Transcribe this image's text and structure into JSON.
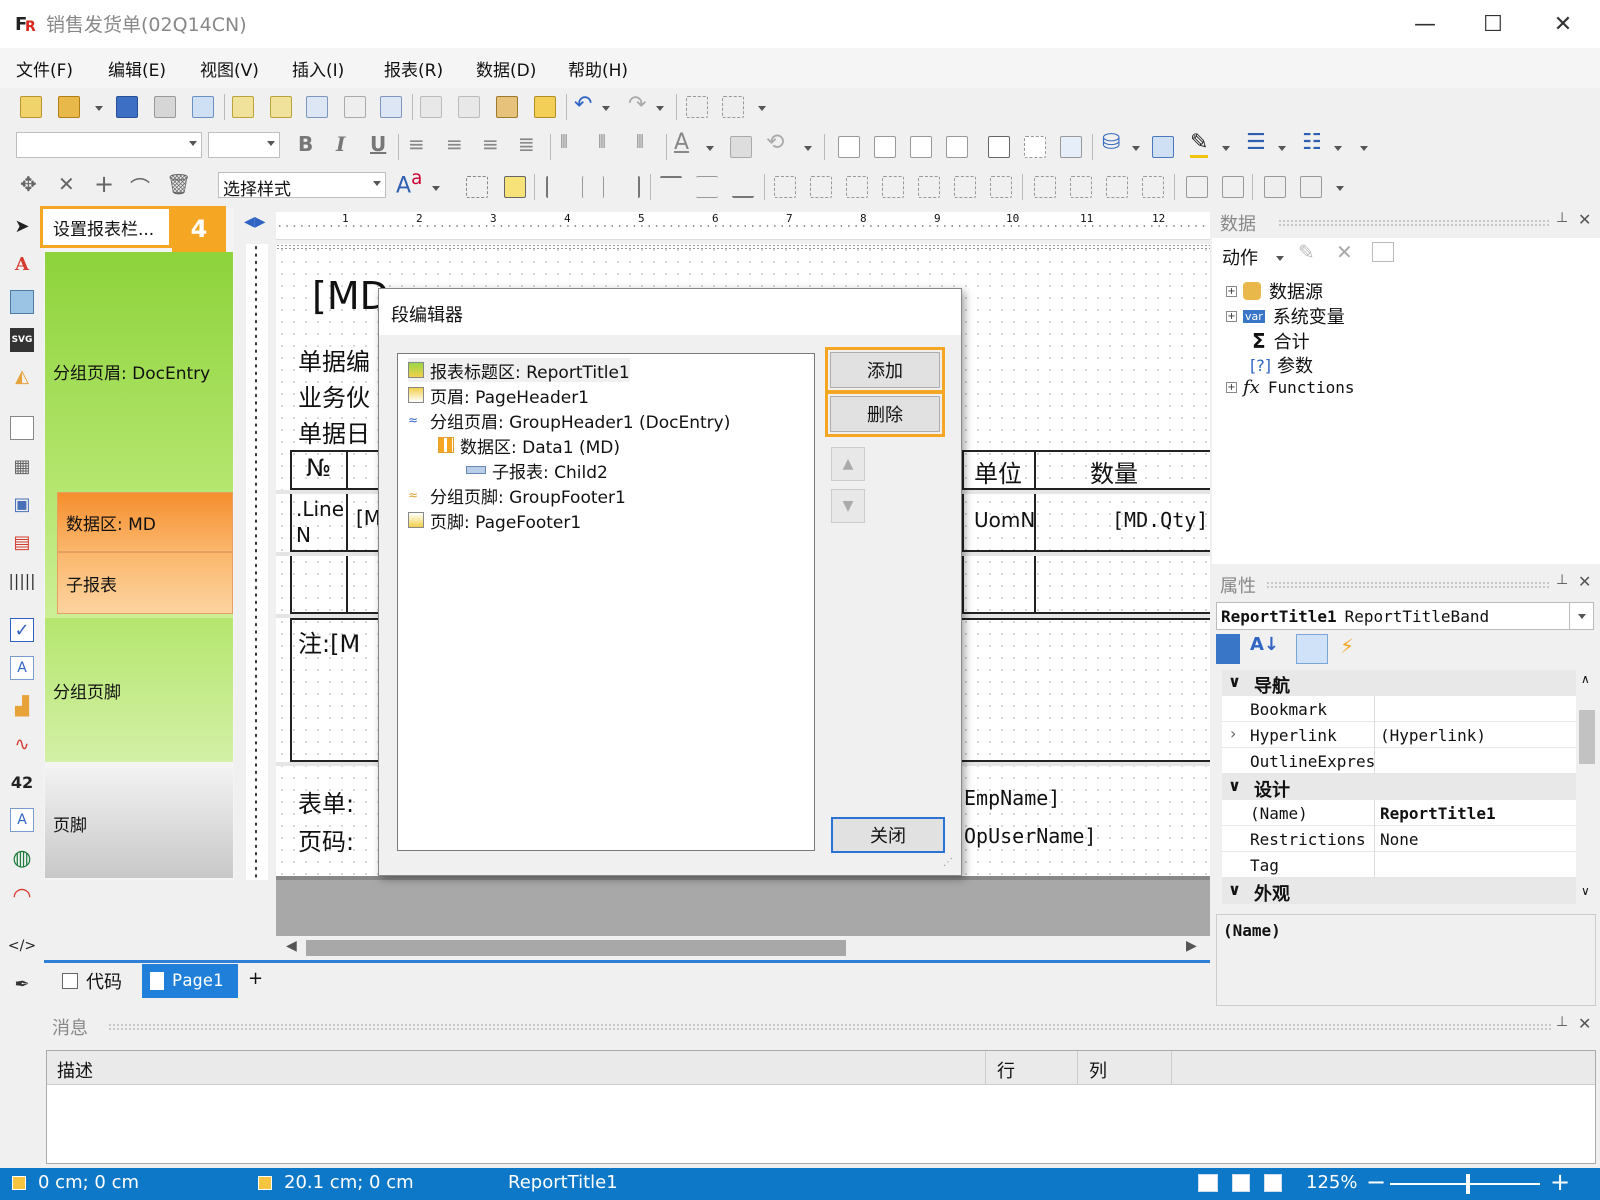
{
  "window": {
    "title": "销售发货单(02Q14CN)",
    "minimize": "—",
    "maximize": "☐",
    "close": "✕"
  },
  "menu": [
    {
      "label": "文件(F)"
    },
    {
      "label": "编辑(E)"
    },
    {
      "label": "视图(V)"
    },
    {
      "label": "插入(I)"
    },
    {
      "label": "报表(R)"
    },
    {
      "label": "数据(D)"
    },
    {
      "label": "帮助(H)"
    }
  ],
  "toolbar": {
    "style_combo": "选择样式",
    "bold": "B",
    "italic": "I",
    "underline": "U"
  },
  "band_panel": {
    "header_button": "设置报表栏...",
    "step_badge": "4",
    "bands": [
      {
        "label": "分组页眉: DocEntry"
      },
      {
        "label": "数据区: MD"
      },
      {
        "label": "子报表"
      },
      {
        "label": "分组页脚"
      },
      {
        "label": "页脚"
      }
    ]
  },
  "ruler": {
    "ticks": [
      "1",
      "2",
      "3",
      "4",
      "5",
      "6",
      "7",
      "8",
      "9",
      "10",
      "11",
      "12"
    ]
  },
  "report": {
    "title_field": "[MD",
    "doc_no": "单据编",
    "partner": "业务伙",
    "doc_date": "单据日",
    "col_no": "№",
    "col_unit": "单位",
    "col_qty": "数量",
    "cell_line": ".LineN",
    "cell_bracket": "[M",
    "cell_uom": "UomN",
    "cell_qty": "[MD.Qty]",
    "note": "注:[M",
    "form": "表单:",
    "emp": "EmpName]",
    "page": "页码:",
    "opuser": "OpUserName]"
  },
  "dialog": {
    "title": "段编辑器",
    "items": [
      {
        "label": "报表标题区: ReportTitle1"
      },
      {
        "label": "页眉: PageHeader1"
      },
      {
        "label": "分组页眉: GroupHeader1 (DocEntry)"
      },
      {
        "label": "数据区: Data1 (MD)"
      },
      {
        "label": "子报表: Child2"
      },
      {
        "label": "分组页脚: GroupFooter1"
      },
      {
        "label": "页脚: PageFooter1"
      }
    ],
    "add_button": "添加",
    "delete_button": "删除",
    "close_button": "关闭"
  },
  "tabs": {
    "code": "代码",
    "page1": "Page1",
    "add": "+"
  },
  "data_panel": {
    "title": "数据",
    "actions": "动作",
    "tree": [
      {
        "label": "数据源"
      },
      {
        "label": "系统变量"
      },
      {
        "label": "合计"
      },
      {
        "label": "参数"
      },
      {
        "label": "Functions"
      }
    ],
    "var_badge": "var"
  },
  "properties_panel": {
    "title": "属性",
    "selector_name": "ReportTitle1",
    "selector_type": "ReportTitleBand",
    "categories": {
      "nav": "导航",
      "design": "设计",
      "appearance": "外观"
    },
    "rows": [
      {
        "name": "Bookmark",
        "value": ""
      },
      {
        "name": "Hyperlink",
        "value": "(Hyperlink)"
      },
      {
        "name": "OutlineExpres",
        "value": ""
      },
      {
        "name": "(Name)",
        "value": "ReportTitle1"
      },
      {
        "name": "Restrictions",
        "value": "None"
      },
      {
        "name": "Tag",
        "value": ""
      }
    ],
    "description": "(Name)"
  },
  "messages": {
    "title": "消息",
    "col_desc": "描述",
    "col_row": "行",
    "col_col": "列"
  },
  "status": {
    "pos1": "0 cm; 0 cm",
    "pos2": "20.1 cm; 0 cm",
    "selection": "ReportTitle1",
    "zoom": "125%",
    "zoom_minus": "−",
    "zoom_plus": "+"
  },
  "colors": {
    "accent_orange": "#f5a623",
    "status_blue": "#0e78c8",
    "band_green": "#9ad848",
    "band_orange": "#f7a04a"
  }
}
